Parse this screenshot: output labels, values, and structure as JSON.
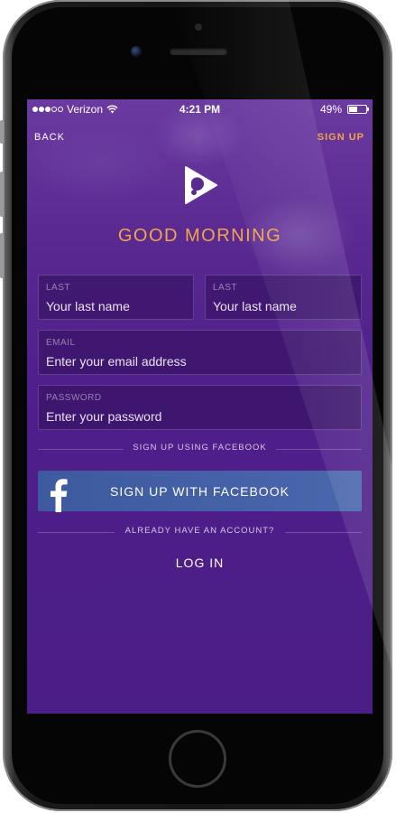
{
  "status_bar": {
    "carrier": "Verizon",
    "time": "4:21 PM",
    "battery_percent_label": "49%",
    "battery_level": 0.49,
    "signal_bars_on": 3,
    "signal_bars_total": 5
  },
  "nav": {
    "back_label": "BACK",
    "signup_label": "SIGN UP"
  },
  "header": {
    "greeting": "GOOD MORNING"
  },
  "form": {
    "first_field": {
      "label": "LAST",
      "placeholder": "Your last name"
    },
    "last_field": {
      "label": "LAST",
      "placeholder": "Your last name"
    },
    "email_field": {
      "label": "EMAIL",
      "placeholder": "Enter your email address"
    },
    "password_field": {
      "label": "PASSWORD",
      "placeholder": "Enter your password"
    }
  },
  "facebook": {
    "divider_label": "SIGN UP USING FACEBOOK",
    "button_label": "SIGN UP WITH FACEBOOK"
  },
  "account": {
    "divider_label": "ALREADY HAVE AN ACCOUNT?",
    "login_label": "LOG IN"
  },
  "colors": {
    "accent": "#f0a548",
    "background": "#4f1f8b",
    "facebook_blue": "#3d5a9f"
  },
  "icons": {
    "app_logo": "play-triangle-logo-icon",
    "facebook": "facebook-f-icon",
    "wifi": "wifi-icon",
    "battery": "battery-icon"
  }
}
